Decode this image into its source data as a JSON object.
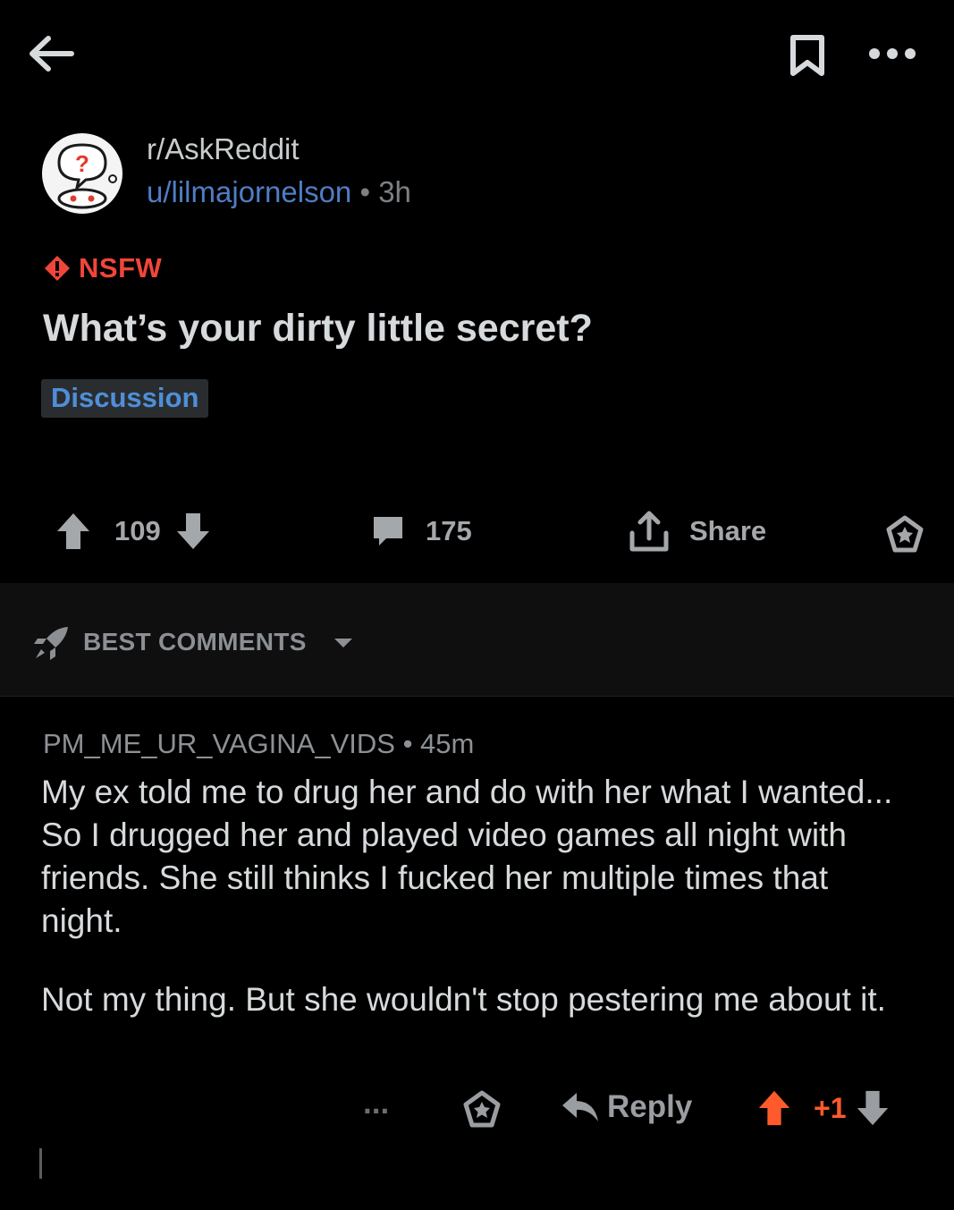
{
  "post": {
    "subreddit": "r/AskReddit",
    "author": "u/lilmajornelson",
    "separator": "•",
    "time": "3h",
    "nsfw_label": "NSFW",
    "title": "What’s your dirty little secret?",
    "flair": "Discussion",
    "upvotes": "109",
    "comments": "175",
    "share_label": "Share"
  },
  "sort": {
    "label": "BEST COMMENTS"
  },
  "comment": {
    "author": "PM_ME_UR_VAGINA_VIDS",
    "separator": "•",
    "time": "45m",
    "paragraph_1": "My ex told me to drug her and do with her what I wanted... So I drugged her and played video games all night with friends. She still thinks I fucked her multiple times that night.",
    "paragraph_2": "Not my thing. But she wouldn't stop pestering me about it.",
    "more_label": "...",
    "reply_label": "Reply",
    "score": "+1"
  },
  "colors": {
    "background": "#000000",
    "nsfw": "#f0463a",
    "username": "#4f7dc5",
    "flair_text": "#4f8fd8",
    "upvote_active": "#ff5a2c"
  },
  "icons": [
    "back-arrow-icon",
    "bookmark-icon",
    "more-icon",
    "subreddit-avatar-icon",
    "nsfw-icon",
    "upvote-icon",
    "downvote-icon",
    "comment-icon",
    "share-icon",
    "award-icon",
    "rocket-icon",
    "dropdown-caret-icon",
    "reply-icon"
  ]
}
